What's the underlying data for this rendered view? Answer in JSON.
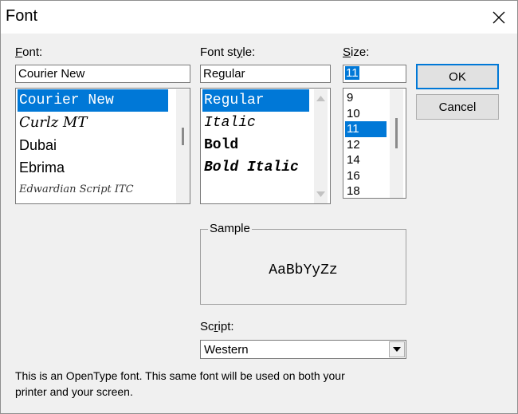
{
  "dialog": {
    "title": "Font"
  },
  "font": {
    "label_first": "F",
    "label_rest": "ont:",
    "value": "Courier New",
    "items": [
      "Courier New",
      "Curlz MT",
      "Dubai",
      "Ebrima",
      "Edwardian Script ITC"
    ],
    "selected_index": 0
  },
  "style": {
    "label_pre": "Font st",
    "label_ul": "y",
    "label_post": "le:",
    "value": "Regular",
    "items": [
      "Regular",
      "Italic",
      "Bold",
      "Bold Italic"
    ],
    "selected_index": 0
  },
  "size": {
    "label_first": "S",
    "label_rest": "ize:",
    "value": "11",
    "items": [
      "9",
      "10",
      "11",
      "12",
      "14",
      "16",
      "18"
    ],
    "selected_index": 2
  },
  "buttons": {
    "ok": "OK",
    "cancel": "Cancel"
  },
  "sample": {
    "label": "Sample",
    "text": "AaBbYyZz"
  },
  "script": {
    "label_pre": "Sc",
    "label_ul": "r",
    "label_post": "ipt:",
    "value": "Western"
  },
  "info": {
    "line1": "This is an OpenType font. This same font will be used on both your",
    "line2": "printer and your screen."
  },
  "colors": {
    "selection": "#0078d7",
    "dialog_bg": "#f0f0f0"
  },
  "icons": {
    "close": "close-icon",
    "dropdown": "chevron-down-icon",
    "scroll_up": "scroll-up-arrow-icon",
    "scroll_down": "scroll-down-arrow-icon"
  }
}
